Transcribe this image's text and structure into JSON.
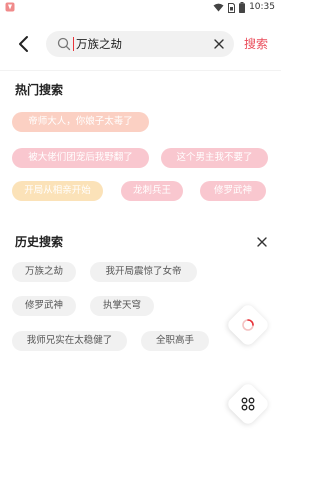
{
  "status_bar": {
    "time": "10:35"
  },
  "search": {
    "query": "万族之劫",
    "submit_label": "搜索"
  },
  "hot": {
    "title": "热门搜索",
    "tags": [
      "帝师大人，你娘子太毒了",
      "被大佬们团宠后我野翻了",
      "这个男主我不要了",
      "开局从相亲开始",
      "龙刺兵王",
      "修罗武神"
    ]
  },
  "history": {
    "title": "历史搜索",
    "tags": [
      "万族之劫",
      "我开局震惊了女帝",
      "修罗武神",
      "执掌天穹",
      "我师兄实在太稳健了",
      "全职高手"
    ]
  },
  "colors": {
    "accent": "#ea4c5a",
    "hot_orange": "#fbd0c3",
    "hot_pink": "#f9c7cf",
    "hot_yellow": "#fbe2b8",
    "history_bg": "#f1f1f1"
  },
  "icons": {
    "back": "arrow-left-icon",
    "search": "search-icon",
    "clear": "close-icon",
    "trash": "close-icon",
    "loading": "loading-ring-icon",
    "grid": "grid-apps-icon"
  }
}
